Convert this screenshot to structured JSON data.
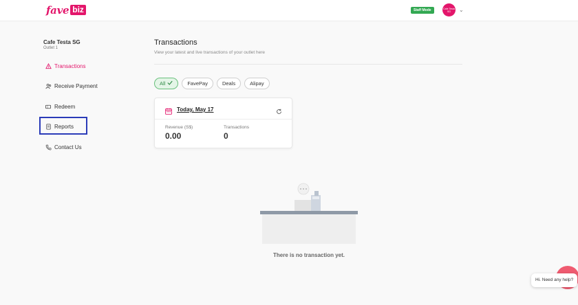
{
  "header": {
    "logo_main": "fave",
    "logo_badge": "biz",
    "staff_mode_label": "Staff Mode",
    "avatar_text": "Cafe Testa SG",
    "brand_color": "#e3166b"
  },
  "sidebar": {
    "outlet_name": "Cafe Testa SG",
    "outlet_sub": "Outlet 1",
    "items": [
      {
        "label": "Transactions",
        "icon": "alert-icon",
        "active": true
      },
      {
        "label": "Receive Payment",
        "icon": "users-icon",
        "active": false
      },
      {
        "label": "Redeem",
        "icon": "ticket-icon",
        "active": false
      },
      {
        "label": "Reports",
        "icon": "document-icon",
        "active": false,
        "highlighted": true
      },
      {
        "label": "Contact Us",
        "icon": "phone-icon",
        "active": false
      }
    ]
  },
  "main": {
    "title": "Transactions",
    "subtitle": "View your latest and live transactions of your outlet here",
    "filters": [
      {
        "label": "All",
        "selected": true
      },
      {
        "label": "FavePay",
        "selected": false
      },
      {
        "label": "Deals",
        "selected": false
      },
      {
        "label": "Alipay",
        "selected": false
      }
    ],
    "summary_card": {
      "date_label": "Today, May 17",
      "revenue_label": "Revenue (S$)",
      "revenue_value": "0.00",
      "transactions_label": "Transactions",
      "transactions_value": "0"
    },
    "empty_state_text": "There is no transaction yet."
  },
  "help": {
    "label": "Hi. Need any help?"
  }
}
